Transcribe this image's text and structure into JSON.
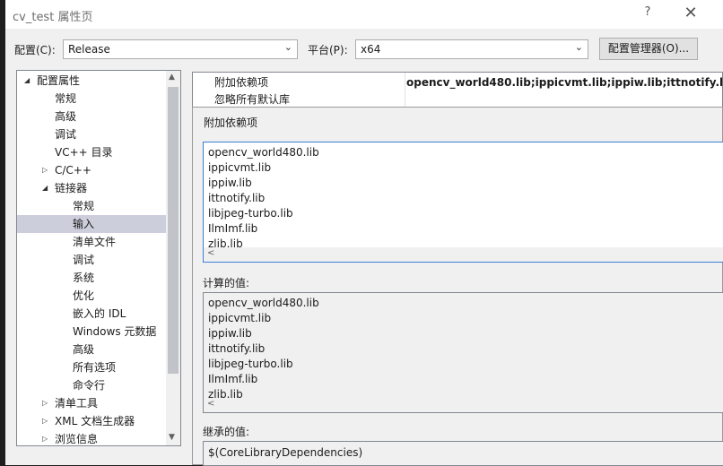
{
  "window": {
    "title": "cv_test 属性页",
    "help": "?",
    "close": "✕"
  },
  "toolbar": {
    "config_label": "配置(C):",
    "config_value": "Release",
    "platform_label": "平台(P):",
    "platform_value": "x64",
    "config_manager": "配置管理器(O)..."
  },
  "tree": [
    {
      "label": "配置属性",
      "indent": 0,
      "toggle": "◢",
      "selected": false
    },
    {
      "label": "常规",
      "indent": 1,
      "toggle": "",
      "selected": false
    },
    {
      "label": "高级",
      "indent": 1,
      "toggle": "",
      "selected": false
    },
    {
      "label": "调试",
      "indent": 1,
      "toggle": "",
      "selected": false
    },
    {
      "label": "VC++ 目录",
      "indent": 1,
      "toggle": "",
      "selected": false
    },
    {
      "label": "C/C++",
      "indent": 1,
      "toggle": "▷",
      "selected": false
    },
    {
      "label": "链接器",
      "indent": 1,
      "toggle": "◢",
      "selected": false
    },
    {
      "label": "常规",
      "indent": 2,
      "toggle": "",
      "selected": false
    },
    {
      "label": "输入",
      "indent": 2,
      "toggle": "",
      "selected": true
    },
    {
      "label": "清单文件",
      "indent": 2,
      "toggle": "",
      "selected": false
    },
    {
      "label": "调试",
      "indent": 2,
      "toggle": "",
      "selected": false
    },
    {
      "label": "系统",
      "indent": 2,
      "toggle": "",
      "selected": false
    },
    {
      "label": "优化",
      "indent": 2,
      "toggle": "",
      "selected": false
    },
    {
      "label": "嵌入的 IDL",
      "indent": 2,
      "toggle": "",
      "selected": false
    },
    {
      "label": "Windows 元数据",
      "indent": 2,
      "toggle": "",
      "selected": false
    },
    {
      "label": "高级",
      "indent": 2,
      "toggle": "",
      "selected": false
    },
    {
      "label": "所有选项",
      "indent": 2,
      "toggle": "",
      "selected": false
    },
    {
      "label": "命令行",
      "indent": 2,
      "toggle": "",
      "selected": false
    },
    {
      "label": "清单工具",
      "indent": 1,
      "toggle": "▷",
      "selected": false
    },
    {
      "label": "XML 文档生成器",
      "indent": 1,
      "toggle": "▷",
      "selected": false
    },
    {
      "label": "浏览信息",
      "indent": 1,
      "toggle": "▷",
      "selected": false
    }
  ],
  "grid": {
    "rows": [
      {
        "name": "附加依赖项",
        "value": "opencv_world480.lib;ippicvmt.lib;ippiw.lib;ittnotify.lib"
      },
      {
        "name": "忽略所有默认库",
        "value": ""
      }
    ]
  },
  "popup": {
    "title": "附加依赖项",
    "edit_lines": [
      "opencv_world480.lib",
      "ippicvmt.lib",
      "ippiw.lib",
      "ittnotify.lib",
      "libjpeg-turbo.lib",
      "IlmImf.lib",
      "zlib.lib"
    ],
    "computed_label": "计算的值:",
    "computed_lines": [
      "opencv_world480.lib",
      "ippicvmt.lib",
      "ippiw.lib",
      "ittnotify.lib",
      "libjpeg-turbo.lib",
      "IlmImf.lib",
      "zlib.lib"
    ],
    "inherited_label": "继承的值:",
    "inherited_lines": [
      "$(CoreLibraryDependencies)"
    ]
  },
  "icons": {
    "scroll_left": "<",
    "scroll_up": "▲",
    "scroll_down": "▼"
  },
  "colors": {
    "selection": "#cccedb",
    "dialog_bg": "#f0f0f0",
    "editor_bg": "#1e1e1e"
  }
}
